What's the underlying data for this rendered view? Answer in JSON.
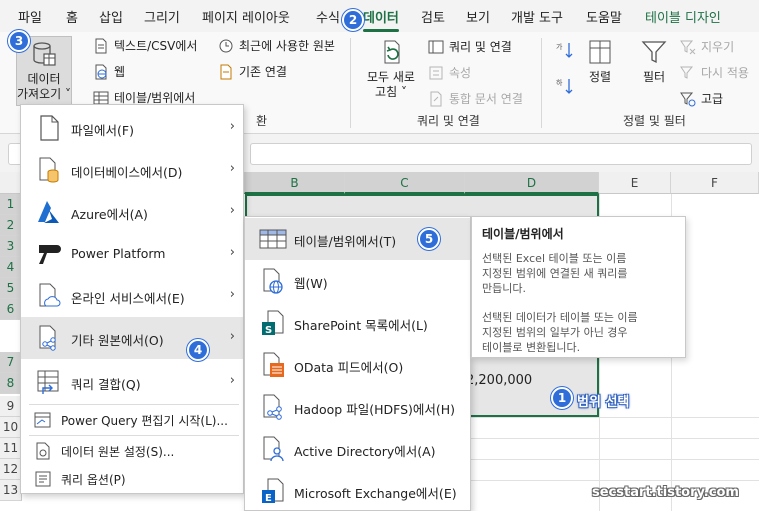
{
  "menubar": {
    "tabs": [
      "파일",
      "홈",
      "삽입",
      "그리기",
      "페이지 레이아웃",
      "수식",
      "데이터",
      "검토",
      "보기",
      "개발 도구",
      "도움말",
      "테이블 디자인"
    ],
    "active": "데이터"
  },
  "ribbon": {
    "get_data": {
      "line1": "데이터",
      "line2": "가져오기 ˅"
    },
    "from_text_csv": "텍스트/CSV에서",
    "from_web": "웹",
    "from_table_range": "테이블/범위에서",
    "recent_sources": "최근에 사용한 원본",
    "existing_connections": "기존 연결",
    "refresh_all": {
      "line1": "모두 새로",
      "line2": "고침 ˅"
    },
    "queries_connections": "쿼리 및 연결",
    "properties": "속성",
    "edit_links": "통합 문서 연결",
    "group_queries": "쿼리 및 연결",
    "sort": "정렬",
    "filter": "필터",
    "clear": "지우기",
    "reapply": "다시 적용",
    "advanced": "고급",
    "group_sort_filter": "정렬 및 필터",
    "group_get_data_tail": "환"
  },
  "sheet": {
    "columns": [
      "B",
      "C",
      "D",
      "E",
      "F"
    ],
    "rows": [
      "1",
      "2",
      "3",
      "4",
      "5",
      "6",
      "7",
      "8",
      "9",
      "10",
      "11",
      "12",
      "13"
    ],
    "visible_value": "2,200,000"
  },
  "menu1": {
    "items": [
      {
        "label": "파일에서(F)",
        "icon": "file-icon"
      },
      {
        "label": "데이터베이스에서(D)",
        "icon": "database-icon"
      },
      {
        "label": "Azure에서(A)",
        "icon": "azure-icon"
      },
      {
        "label": "Power Platform",
        "icon": "power-platform-icon"
      },
      {
        "label": "온라인 서비스에서(E)",
        "icon": "cloud-icon"
      },
      {
        "label": "기타 원본에서(O)",
        "icon": "other-sources-icon"
      },
      {
        "label": "쿼리 결합(Q)",
        "icon": "combine-queries-icon"
      }
    ],
    "small_items": [
      {
        "label": "Power Query 편집기 시작(L)...",
        "icon": "power-query-icon"
      },
      {
        "label": "데이터 원본 설정(S)...",
        "icon": "data-source-settings-icon"
      },
      {
        "label": "쿼리 옵션(P)",
        "icon": "query-options-icon"
      }
    ]
  },
  "menu2": {
    "items": [
      {
        "label": "테이블/범위에서(T)",
        "icon": "table-icon"
      },
      {
        "label": "웹(W)",
        "icon": "web-icon"
      },
      {
        "label": "SharePoint 목록에서(L)",
        "icon": "sharepoint-icon"
      },
      {
        "label": "OData 피드에서(O)",
        "icon": "odata-icon"
      },
      {
        "label": "Hadoop 파일(HDFS)에서(H)",
        "icon": "hadoop-icon"
      },
      {
        "label": "Active Directory에서(A)",
        "icon": "active-directory-icon"
      },
      {
        "label": "Microsoft Exchange에서(E)",
        "icon": "exchange-icon"
      }
    ]
  },
  "tooltip": {
    "title": "테이블/범위에서",
    "para1": "선택된 Excel 테이블 또는 이름\n지정된 범위에 연결된 새 쿼리를\n만듭니다.",
    "para2": "선택된 데이터가 테이블 또는 이름\n지정된 범위의 일부가 아닌 경우\n테이블로 변환됩니다."
  },
  "badges": [
    "1",
    "2",
    "3",
    "4",
    "5"
  ],
  "annotation": "범위 선택",
  "watermark": "secstart.tistory.com",
  "colors": {
    "excel_green": "#1e7145",
    "badge_blue": "#2f6dd9"
  }
}
